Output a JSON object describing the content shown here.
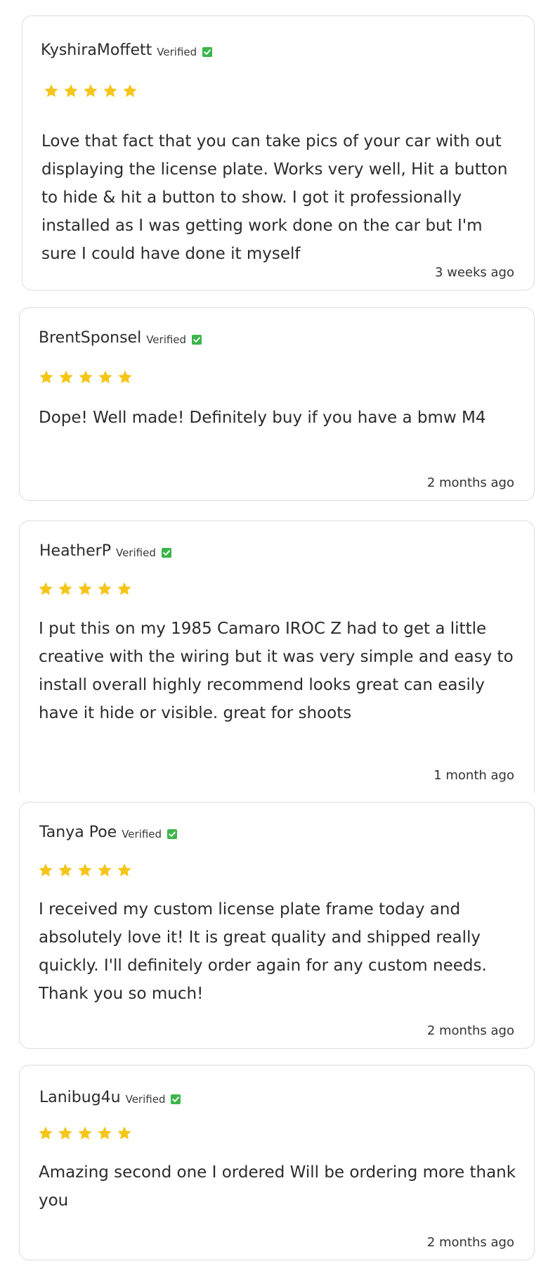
{
  "theme": {
    "star_color": "#f5c518",
    "verified_color": "#3bb54a",
    "border_color": "#dcdcdc"
  },
  "icons": {
    "star": "star-icon",
    "verified": "verified-checkbox-icon"
  },
  "reviews": [
    {
      "name": "KyshiraMoffett",
      "verified_label": "Verified",
      "rating": 5,
      "text": "Love that fact that you can take pics of your car with out displaying the license plate. Works very well, Hit a button to hide & hit a button to show. I got it professionally installed as I was getting work done on the car but I'm sure I could have done it myself",
      "date": "3 weeks ago"
    },
    {
      "name": "BrentSponsel",
      "verified_label": "Verified",
      "rating": 5,
      "text": "Dope! Well made! Definitely buy if you have a bmw M4",
      "date": "2 months ago"
    },
    {
      "name": "HeatherP",
      "verified_label": "Verified",
      "rating": 5,
      "text": "I put this on my 1985 Camaro IROC Z had to get a little creative with the wiring but it was very simple and easy to install overall highly recommend looks great can easily have it hide or visible. great for shoots",
      "date": "1 month ago"
    },
    {
      "name": "Tanya Poe",
      "verified_label": "Verified",
      "rating": 5,
      "text": "I received my custom license plate frame today and absolutely love it! It is great quality and shipped really quickly. I'll definitely order again for any custom needs. Thank you so much!",
      "date": "2 months ago"
    },
    {
      "name": "Lanibug4u",
      "verified_label": "Verified",
      "rating": 5,
      "text": "Amazing second one I ordered Will be ordering more thank you",
      "date": "2 months ago"
    }
  ]
}
